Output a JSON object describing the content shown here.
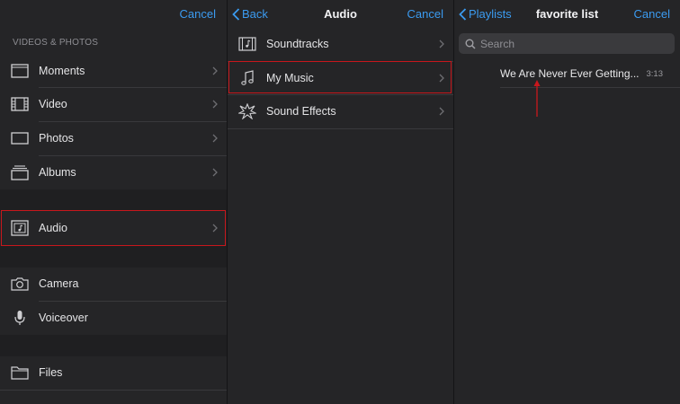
{
  "left_panel": {
    "cancel_label": "Cancel",
    "section_header": "VIDEOS & PHOTOS",
    "items": [
      {
        "label": "Moments",
        "icon": "moments-icon"
      },
      {
        "label": "Video",
        "icon": "film-icon"
      },
      {
        "label": "Photos",
        "icon": "photo-icon"
      },
      {
        "label": "Albums",
        "icon": "albums-icon"
      },
      {
        "label": "Audio",
        "icon": "audio-icon"
      },
      {
        "label": "Camera",
        "icon": "camera-icon"
      },
      {
        "label": "Voiceover",
        "icon": "microphone-icon"
      },
      {
        "label": "Files",
        "icon": "folder-icon"
      }
    ]
  },
  "middle_panel": {
    "back_label": "Back",
    "title": "Audio",
    "cancel_label": "Cancel",
    "items": [
      {
        "label": "Soundtracks",
        "icon": "soundtrack-icon"
      },
      {
        "label": "My Music",
        "icon": "music-note-icon"
      },
      {
        "label": "Sound Effects",
        "icon": "sound-effects-icon"
      }
    ]
  },
  "right_panel": {
    "back_label": "Playlists",
    "title": "favorite list",
    "cancel_label": "Cancel",
    "search_placeholder": "Search",
    "songs": [
      {
        "title": "We Are Never Ever Getting...",
        "duration": "3:13"
      }
    ]
  },
  "colors": {
    "accent": "#3b9bf0",
    "highlight": "#c8171c",
    "background": "#252527"
  }
}
